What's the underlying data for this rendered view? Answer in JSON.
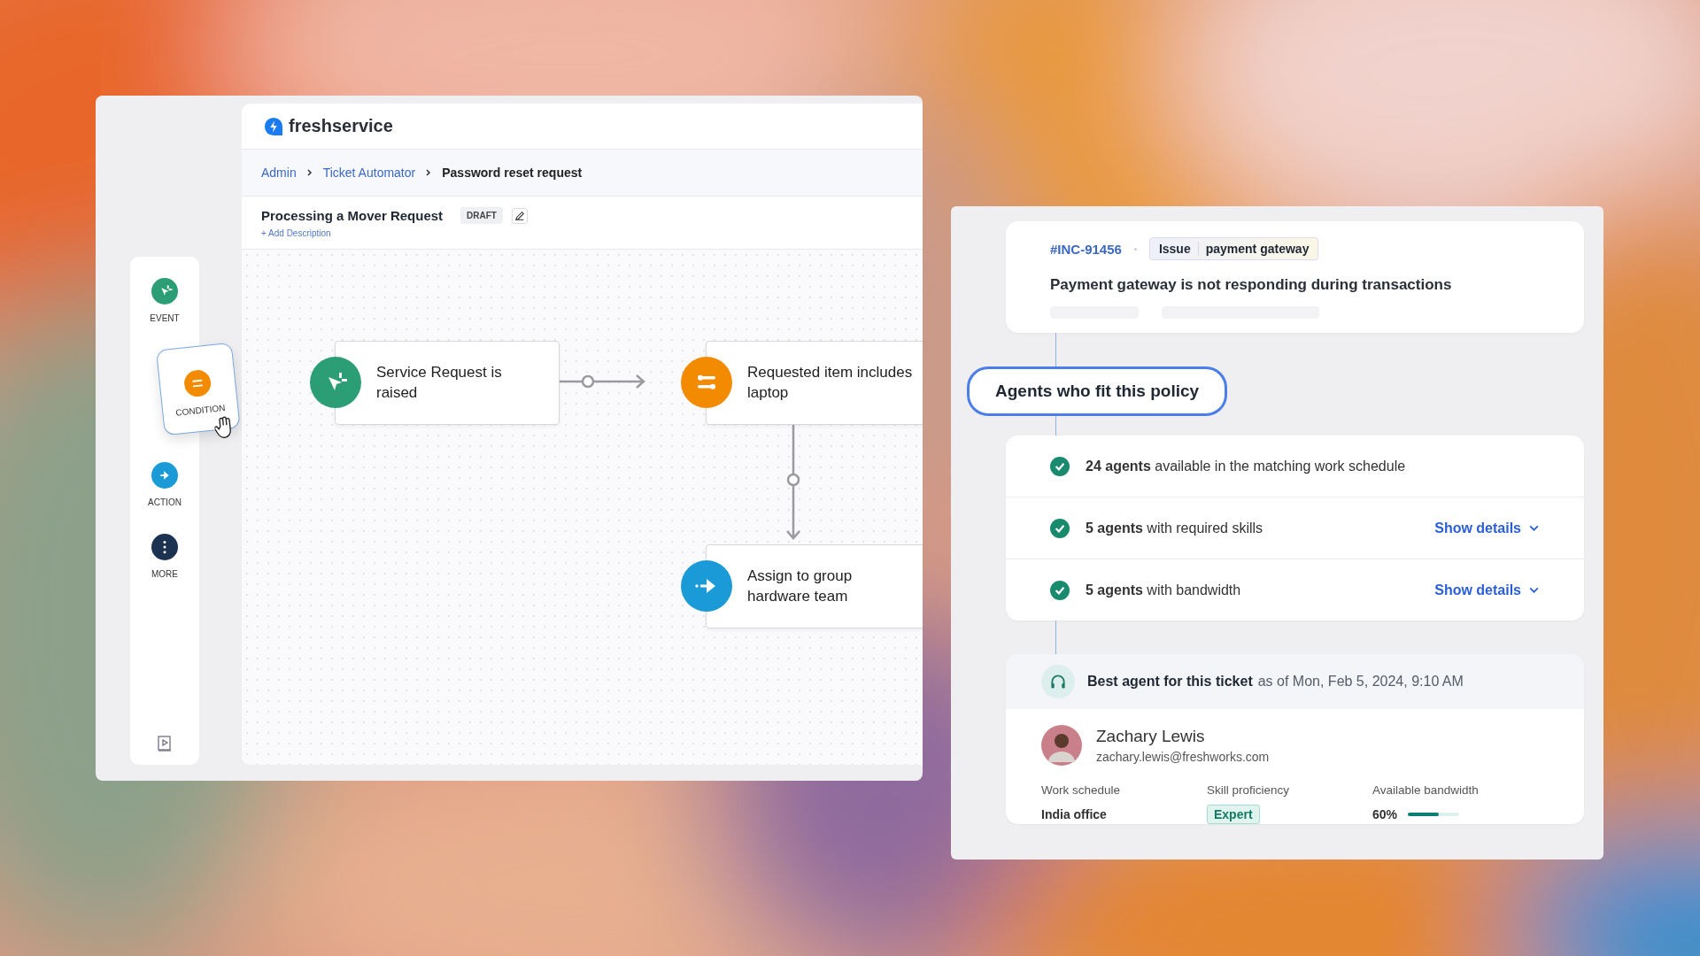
{
  "builder": {
    "logo": "freshservice",
    "breadcrumb": [
      {
        "label": "Admin",
        "kind": "link"
      },
      {
        "label": "Ticket Automator",
        "kind": "link"
      },
      {
        "label": "Password reset request",
        "kind": "current"
      }
    ],
    "workflow_title": "Processing a Mover Request",
    "status_badge": "DRAFT",
    "add_description": "+ Add Description",
    "palette": [
      {
        "label": "EVENT",
        "kind": "event",
        "dragging": false
      },
      {
        "label": "CONDITION",
        "kind": "condition",
        "dragging": true
      },
      {
        "label": "ACTION",
        "kind": "action",
        "dragging": false
      },
      {
        "label": "MORE",
        "kind": "more",
        "dragging": false
      }
    ],
    "nodes": [
      {
        "kind": "event",
        "text": "Service Request is raised"
      },
      {
        "kind": "condition",
        "text": "Requested item includes laptop"
      },
      {
        "kind": "action",
        "text": "Assign to group hardware team"
      }
    ]
  },
  "assignment": {
    "ticket": {
      "id": "#INC-91456",
      "tag_label": "Issue",
      "tag_value": "payment gateway",
      "subject": "Payment gateway is not responding during transactions"
    },
    "policy_pill": "Agents who fit this policy",
    "checks": [
      {
        "text": "**24 agents** available in the matching work schedule",
        "passed": true
      },
      {
        "text": "**5 agents** with required skills",
        "passed": true,
        "details": "Show details"
      },
      {
        "text": "**5 agents** with bandwidth",
        "passed": true,
        "details": "Show details"
      }
    ],
    "best_agent": {
      "title": "Best agent for this ticket",
      "as_of": "as of Mon, Feb 5, 2024, 9:10 AM",
      "name": "Zachary Lewis",
      "email": "zachary.lewis@freshworks.com",
      "fields": [
        {
          "label": "Work schedule",
          "value": "India office",
          "kind": "text"
        },
        {
          "label": "Skill proficiency",
          "value": "Expert",
          "kind": "tag"
        },
        {
          "label": "Available bandwidth",
          "value": "60%",
          "kind": "meter",
          "level": 0.6
        }
      ]
    }
  }
}
